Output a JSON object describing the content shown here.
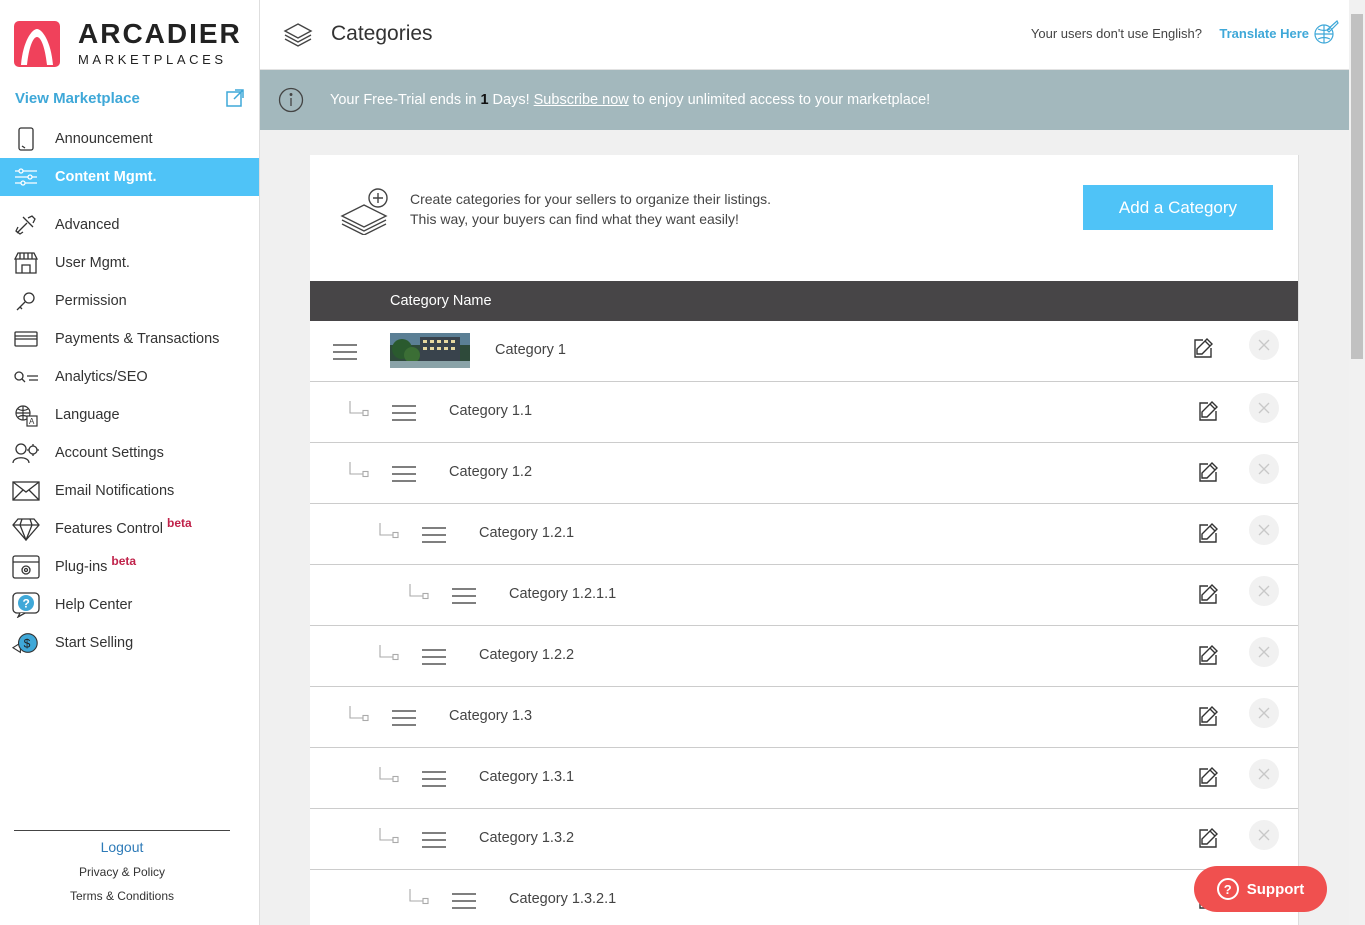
{
  "brand": {
    "title": "ARCADIER",
    "subtitle": "MARKETPLACES",
    "accent": "#f0415b"
  },
  "sidebar": {
    "view_marketplace": "View Marketplace",
    "items": [
      {
        "label": "Announcement",
        "icon": "tablet-icon"
      },
      {
        "label": "Content Mgmt.",
        "icon": "sliders-icon",
        "active": true
      },
      {
        "label": "Advanced",
        "icon": "tools-icon"
      },
      {
        "label": "User Mgmt.",
        "icon": "storefront-icon"
      },
      {
        "label": "Permission",
        "icon": "key-icon"
      },
      {
        "label": "Payments & Transactions",
        "icon": "card-icon"
      },
      {
        "label": "Analytics/SEO",
        "icon": "analytics-icon"
      },
      {
        "label": "Language",
        "icon": "language-icon"
      },
      {
        "label": "Account Settings",
        "icon": "account-gear-icon"
      },
      {
        "label": "Email Notifications",
        "icon": "envelope-icon"
      },
      {
        "label": "Features Control",
        "icon": "diamond-icon",
        "badge": "beta"
      },
      {
        "label": "Plug-ins",
        "icon": "plugin-box-icon",
        "badge": "beta"
      },
      {
        "label": "Help Center",
        "icon": "help-bubble-icon"
      },
      {
        "label": "Start Selling",
        "icon": "dollar-rocket-icon"
      }
    ],
    "logout": "Logout",
    "privacy": "Privacy & Policy",
    "terms": "Terms & Conditions"
  },
  "header": {
    "title": "Categories",
    "translate_question": "Your users don't use English?",
    "translate_link": "Translate Here"
  },
  "banner": {
    "prefix": "Your Free-Trial ends in ",
    "days": "1",
    "days_suffix": " Days! ",
    "link": "Subscribe now",
    "suffix": " to enjoy unlimited access to your marketplace!"
  },
  "intro": {
    "line1": "Create categories for your sellers to organize their listings.",
    "line2": "This way, your buyers can find what they want easily!",
    "add_button": "Add a Category"
  },
  "table": {
    "header": "Category Name",
    "rows": [
      {
        "name": "Category 1",
        "level": 0,
        "has_image": true
      },
      {
        "name": "Category 1.1",
        "level": 1
      },
      {
        "name": "Category 1.2",
        "level": 1
      },
      {
        "name": "Category 1.2.1",
        "level": 2
      },
      {
        "name": "Category 1.2.1.1",
        "level": 3
      },
      {
        "name": "Category 1.2.2",
        "level": 2
      },
      {
        "name": "Category 1.3",
        "level": 1
      },
      {
        "name": "Category 1.3.1",
        "level": 2
      },
      {
        "name": "Category 1.3.2",
        "level": 2
      },
      {
        "name": "Category 1.3.2.1",
        "level": 3
      }
    ]
  },
  "support": {
    "label": "Support",
    "color": "#f0504f"
  }
}
